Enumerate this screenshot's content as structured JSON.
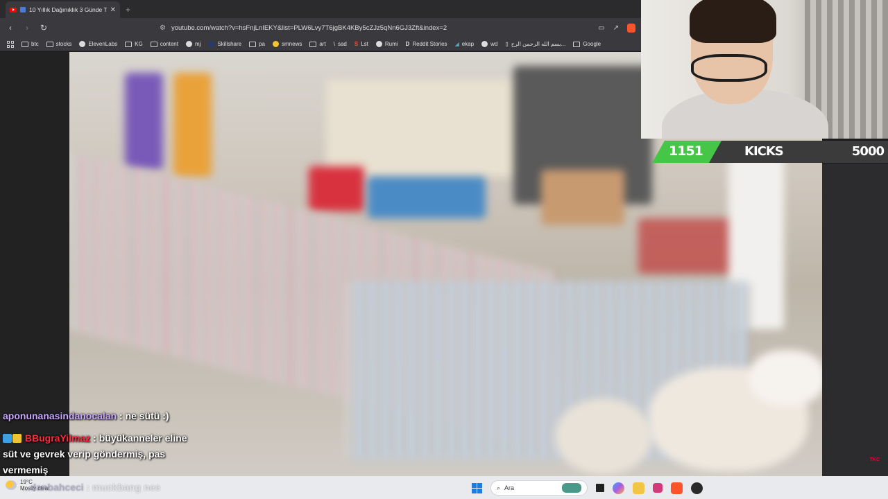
{
  "browser": {
    "tab_title": "10 Yıllık Dağınıklık 3 Günde T...",
    "new_tab": "+",
    "url": "youtube.com/watch?v=hsFnjLnIEKY&list=PLW6Lvy7T6jgBK4KBy5cZJz5qNn6GJ3Zft&index=2",
    "bookmarks": [
      "btc",
      "stocks",
      "ElevenLabs",
      "KG",
      "content",
      "mj",
      "Skillshare",
      "pa",
      "smnews",
      "art",
      "sad",
      "Lst",
      "Rumi",
      "Reddit Stories",
      "ekap",
      "wd",
      "بسم الله الرحمن الرح...",
      "Google"
    ]
  },
  "overlay": {
    "count": "1151",
    "label": "KICKS",
    "goal": "5000",
    "accent": "#46c646"
  },
  "chat": [
    {
      "user": "aponunanasindanocalan",
      "text": " : ne sütü :)"
    },
    {
      "user": "BBugraYilmaz",
      "text": " : büyükanneler eline",
      "cont": [
        "süt ve gevrek verip göndermiş, pas",
        "vermemiş"
      ]
    }
  ],
  "faded_chat": {
    "user": "...danbahceci",
    "text": " : muckbang nee"
  },
  "taskbar": {
    "temp": "19°C",
    "weather": "Mostly clear",
    "search": "Ara"
  },
  "watermark": "TKC"
}
